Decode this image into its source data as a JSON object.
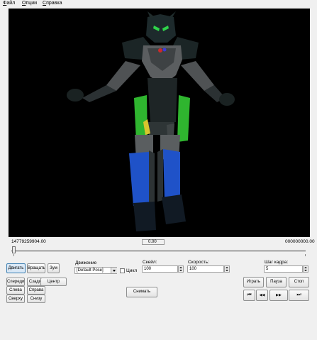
{
  "menu": [
    {
      "label": "Файл"
    },
    {
      "label": "Опции"
    },
    {
      "label": "Справка"
    }
  ],
  "timeline": {
    "start": "14779259904.00",
    "current": "0.00",
    "end": "000000000.00"
  },
  "buttons": {
    "move": "Двигать",
    "rotate": "Вращать",
    "zoom": "Зум",
    "front": "Спереди",
    "back": "Сзади",
    "center": "Центр",
    "left": "Слева",
    "right": "Справа",
    "top": "Сверху",
    "bottom": "Снизу",
    "snapshot": "Снимать",
    "play": "Играть",
    "pause": "Пауза",
    "stop": "Стоп",
    "first": "⏮",
    "prev": "◀◀",
    "next": "▶▶",
    "last": "⏭"
  },
  "motion": {
    "label": "Движение",
    "value": "[Default Pose]",
    "loop_label": "Цикл"
  },
  "scale": {
    "label": "Скейл:",
    "value": "100"
  },
  "speed": {
    "label": "Скорость:",
    "value": "100"
  },
  "frame_step": {
    "label": "Шаг кадра:",
    "value": "5"
  },
  "colors": {
    "viewport_bg": "#000000"
  }
}
